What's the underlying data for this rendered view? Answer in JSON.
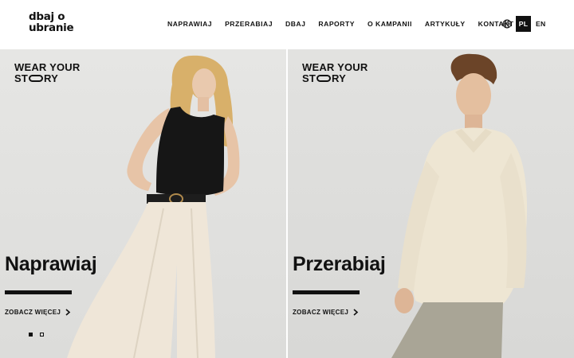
{
  "brand": {
    "logo_line1": "dbaj o",
    "logo_line2": "ubranie"
  },
  "nav": {
    "items": [
      "NAPRAWIAJ",
      "PRZERABIAJ",
      "DBAJ",
      "RAPORTY",
      "O KAMPANII",
      "ARTYKUŁY",
      "KONTAKT"
    ]
  },
  "language": {
    "icon": "globe-icon",
    "active": "PL",
    "other": "EN"
  },
  "panels": [
    {
      "tagline_line1": "WEAR YOUR",
      "tagline_line2_pre": "ST",
      "tagline_line2_post": "RY",
      "title": "Naprawiaj",
      "link": "ZOBACZ WIĘCEJ",
      "link_icon": "chevron-right-icon"
    },
    {
      "tagline_line1": "WEAR YOUR",
      "tagline_line2_pre": "ST",
      "tagline_line2_post": "RY",
      "title": "Przerabiaj",
      "link": "ZOBACZ WIĘCEJ",
      "link_icon": "chevron-right-icon"
    }
  ],
  "carousel": {
    "slides": 2,
    "active_index": 0
  },
  "colors": {
    "text": "#111111",
    "background": "#ffffff",
    "panel": "#e2e2e0"
  }
}
